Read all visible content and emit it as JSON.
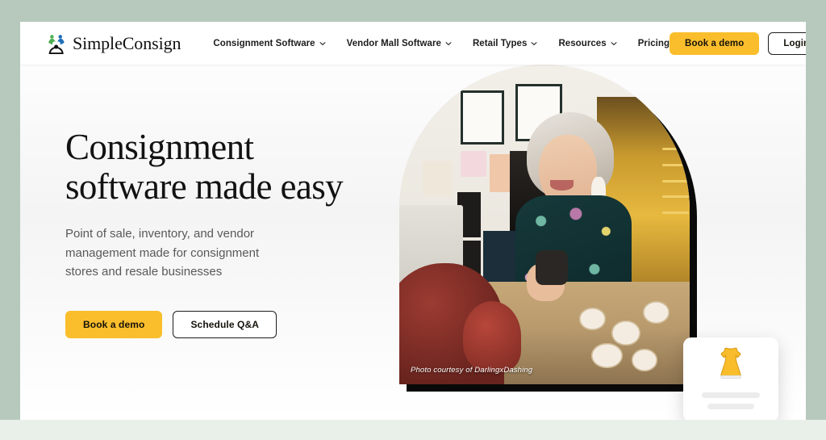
{
  "site": {
    "brand_name": "SimpleConsign",
    "logo_icon": "two-figures-logo-icon",
    "accent_yellow": "#fabe2c",
    "page_border_color": "#b6c9bc",
    "bottom_band_color": "#e9f0e9"
  },
  "header": {
    "nav": [
      {
        "label": "Consignment Software",
        "has_dropdown": true,
        "icon": "chevron-down-icon"
      },
      {
        "label": "Vendor Mall Software",
        "has_dropdown": true,
        "icon": "chevron-down-icon"
      },
      {
        "label": "Retail Types",
        "has_dropdown": true,
        "icon": "chevron-down-icon"
      },
      {
        "label": "Resources",
        "has_dropdown": true,
        "icon": "chevron-down-icon"
      },
      {
        "label": "Pricing",
        "has_dropdown": false,
        "icon": ""
      }
    ],
    "book_demo_label": "Book a demo",
    "login_label": "Login"
  },
  "hero": {
    "headline": "Consignment\nsoftware made easy",
    "subhead": "Point of sale, inventory, and vendor\nmanagement made for consignment\nstores and resale businesses",
    "primary_cta": "Book a demo",
    "secondary_cta": "Schedule Q&A",
    "photo_credit": "Photo courtesy of DarlingxDashing",
    "image_alt": "Shop owner smiling behind counter in consignment store",
    "product_card": {
      "icon": "yellow-dress-icon",
      "icon_color": "#f9bd2b",
      "placeholder_lines": 2
    }
  }
}
